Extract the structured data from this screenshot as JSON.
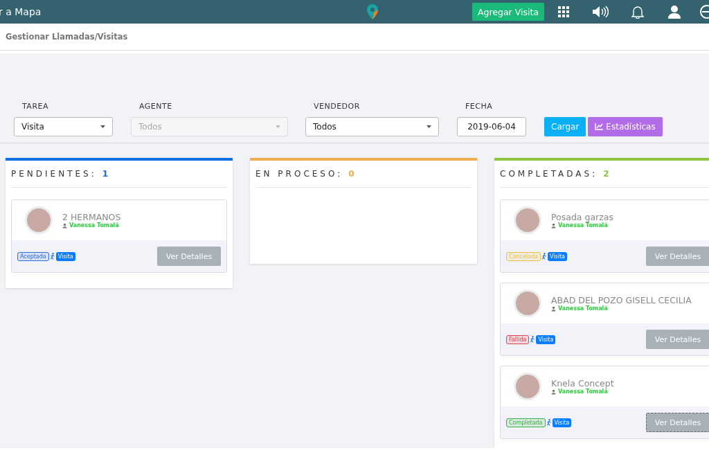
{
  "topbar": {
    "back_link": "r a Mapa",
    "add_button": "Agregar Visita"
  },
  "breadcrumb": "Gestionar Llamadas/Visitas",
  "filters": [
    {
      "label": "TAREA",
      "kind": "select",
      "value": "Visita",
      "disabled": false
    },
    {
      "label": "AGENTE",
      "kind": "select",
      "value": "Todos",
      "disabled": true
    },
    {
      "label": "VENDEDOR",
      "kind": "select",
      "value": "Todos",
      "disabled": false
    },
    {
      "label": "FECHA",
      "kind": "date",
      "value": "2019-06-04",
      "disabled": false
    }
  ],
  "actions": [
    {
      "label": "Cargar",
      "kind": "load"
    },
    {
      "label": "Estadísticas",
      "kind": "stats"
    }
  ],
  "columns": [
    {
      "title": "PENDIENTES:",
      "count": "1",
      "color": "#0d6fe0",
      "cards": [
        {
          "name": "2 HERMANOS",
          "agent": "Vanessa Tomalá",
          "status": "Aceptada",
          "color": "#2f6fd6",
          "type": "Visita",
          "button": "Ver Detalles",
          "focused": false
        }
      ]
    },
    {
      "title": "EN PROCESO:",
      "count": "0",
      "color": "#f0ad4e"
    },
    {
      "title": "COMPLETADAS:",
      "count": "2",
      "color": "#8cc63f",
      "cards": [
        {
          "name": "Posada garzas",
          "agent": "Vanessa Tomalá",
          "status": "Cancelada",
          "color": "#f0c040",
          "type": "Visita",
          "button": "Ver Detalles",
          "focused": false
        },
        {
          "name": "ABAD DEL POZO GISELL CECILIA",
          "agent": "Vanessa Tomalá",
          "status": "Fallida",
          "color": "#e0404a",
          "type": "Visita",
          "button": "Ver Detalles",
          "focused": false
        },
        {
          "name": "Knela Concept",
          "agent": "Vanessa Tomalá",
          "status": "Completada",
          "color": "#3cb043",
          "type": "Visita",
          "button": "Ver Detalles",
          "focused": true
        }
      ]
    }
  ]
}
